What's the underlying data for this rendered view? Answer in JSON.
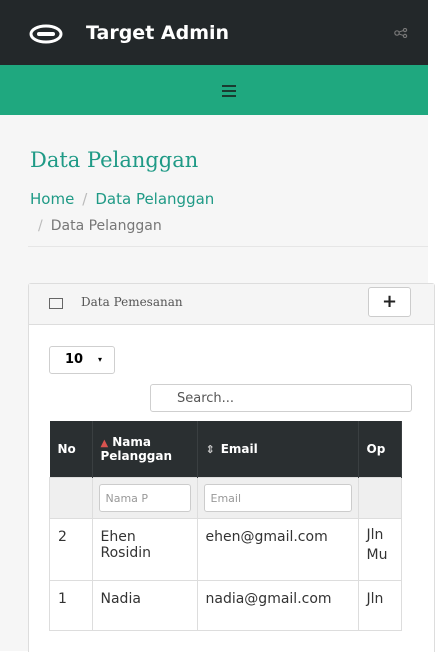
{
  "header": {
    "app_title": "Target Admin",
    "logo_icon": "eye-logo-icon",
    "share_icon": "share-icon"
  },
  "nav": {
    "menu_icon": "hamburger-icon"
  },
  "page": {
    "title": "Data Pelanggan",
    "breadcrumb": [
      "Home",
      "Data Pelanggan",
      "Data Pelanggan"
    ],
    "separator": "/"
  },
  "panel": {
    "title": "Data Pemesanan",
    "add_label": "+",
    "length_value": "10",
    "length_caret": "▾",
    "search_placeholder": "Search..."
  },
  "table": {
    "headers": [
      "No",
      "Nama Pelanggan",
      "Email",
      "Op"
    ],
    "sort_up": "▲",
    "sort_both": "⇕",
    "filters": [
      "Nama P",
      "Email"
    ],
    "rows": [
      {
        "no": "2",
        "nama": "Ehen Rosidin",
        "email": "ehen@gmail.com",
        "alamat": "Jln Mu"
      },
      {
        "no": "1",
        "nama": "Nadia",
        "email": "nadia@gmail.com",
        "alamat": "Jln"
      }
    ]
  },
  "colors": {
    "topbar": "#23282a",
    "accent": "#1fa87f",
    "title": "#1f9a86"
  }
}
